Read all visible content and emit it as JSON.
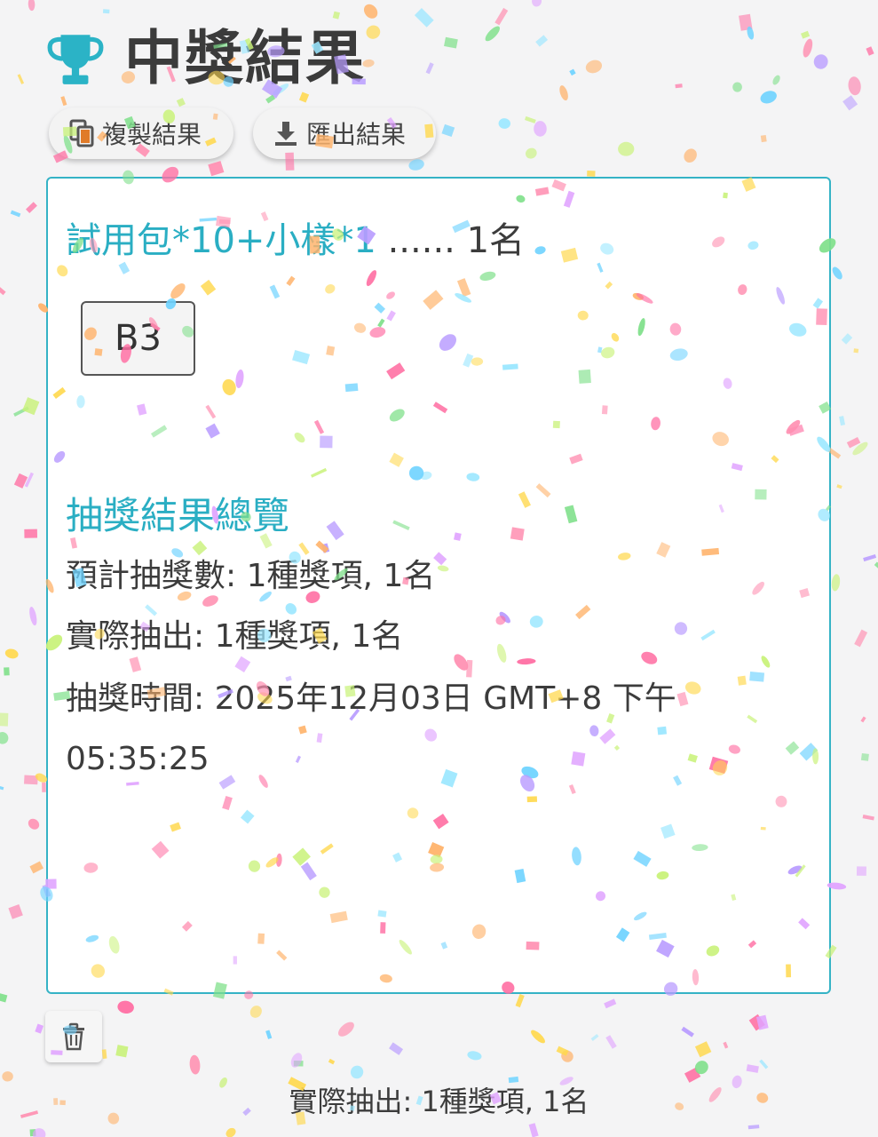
{
  "header": {
    "title": "中獎結果",
    "icon": "trophy-icon",
    "icon_color": "#2bb3c6"
  },
  "toolbar": {
    "copy_label": "複製結果",
    "copy_icon": "copy-icon",
    "export_label": "匯出結果",
    "export_icon": "download-icon"
  },
  "result": {
    "prize_name": "試用包*10+小樣*1",
    "prize_count": " ...... 1名",
    "winners": [
      "B3"
    ]
  },
  "summary": {
    "title": "抽獎結果總覽",
    "planned": "預計抽獎數: 1種獎項, 1名",
    "actual": "實際抽出: 1種獎項, 1名",
    "time_line1": "抽獎時間: 2025年12月03日 GMT+8 下午",
    "time_line2": "05:35:25"
  },
  "actions": {
    "delete_icon": "trash-icon"
  },
  "footer": {
    "summary": "實際抽出: 1種獎項, 1名"
  },
  "colors": {
    "accent": "#2aaec3",
    "border": "#35b3c6",
    "background": "#f4f4f5"
  }
}
